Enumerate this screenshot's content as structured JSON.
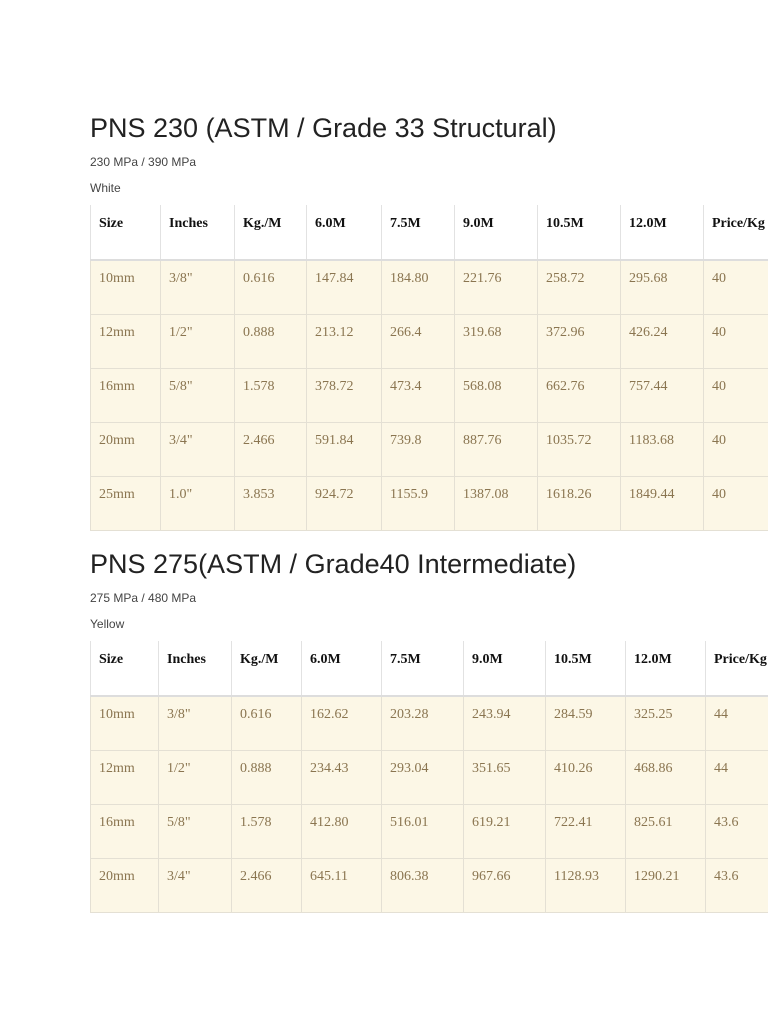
{
  "columns": [
    "Size",
    "Inches",
    "Kg./M",
    "6.0M",
    "7.5M",
    "9.0M",
    "10.5M",
    "12.0M",
    "Price/Kg"
  ],
  "sections": [
    {
      "title": "PNS 230 (ASTM / Grade 33 Structural)",
      "strength": "230 MPa / 390 MPa",
      "color": "White",
      "rows": [
        [
          "10mm",
          "3/8\"",
          "0.616",
          "147.84",
          "184.80",
          "221.76",
          "258.72",
          "295.68",
          "40"
        ],
        [
          "12mm",
          "1/2\"",
          "0.888",
          "213.12",
          "266.4",
          "319.68",
          "372.96",
          "426.24",
          "40"
        ],
        [
          "16mm",
          "5/8\"",
          "1.578",
          "378.72",
          "473.4",
          "568.08",
          "662.76",
          "757.44",
          "40"
        ],
        [
          "20mm",
          "3/4\"",
          "2.466",
          "591.84",
          "739.8",
          "887.76",
          "1035.72",
          "1183.68",
          "40"
        ],
        [
          "25mm",
          "1.0\"",
          "3.853",
          "924.72",
          "1155.9",
          "1387.08",
          "1618.26",
          "1849.44",
          "40"
        ]
      ]
    },
    {
      "title": "PNS 275(ASTM / Grade40 Intermediate)",
      "strength": "275 MPa / 480 MPa",
      "color": "Yellow",
      "rows": [
        [
          "10mm",
          "3/8\"",
          "0.616",
          "162.62",
          "203.28",
          "243.94",
          "284.59",
          "325.25",
          "44"
        ],
        [
          "12mm",
          "1/2\"",
          "0.888",
          "234.43",
          "293.04",
          "351.65",
          "410.26",
          "468.86",
          "44"
        ],
        [
          "16mm",
          "5/8\"",
          "1.578",
          "412.80",
          "516.01",
          "619.21",
          "722.41",
          "825.61",
          "43.6"
        ],
        [
          "20mm",
          "3/4\"",
          "2.466",
          "645.11",
          "806.38",
          "967.66",
          "1128.93",
          "1290.21",
          "43.6"
        ]
      ]
    }
  ]
}
